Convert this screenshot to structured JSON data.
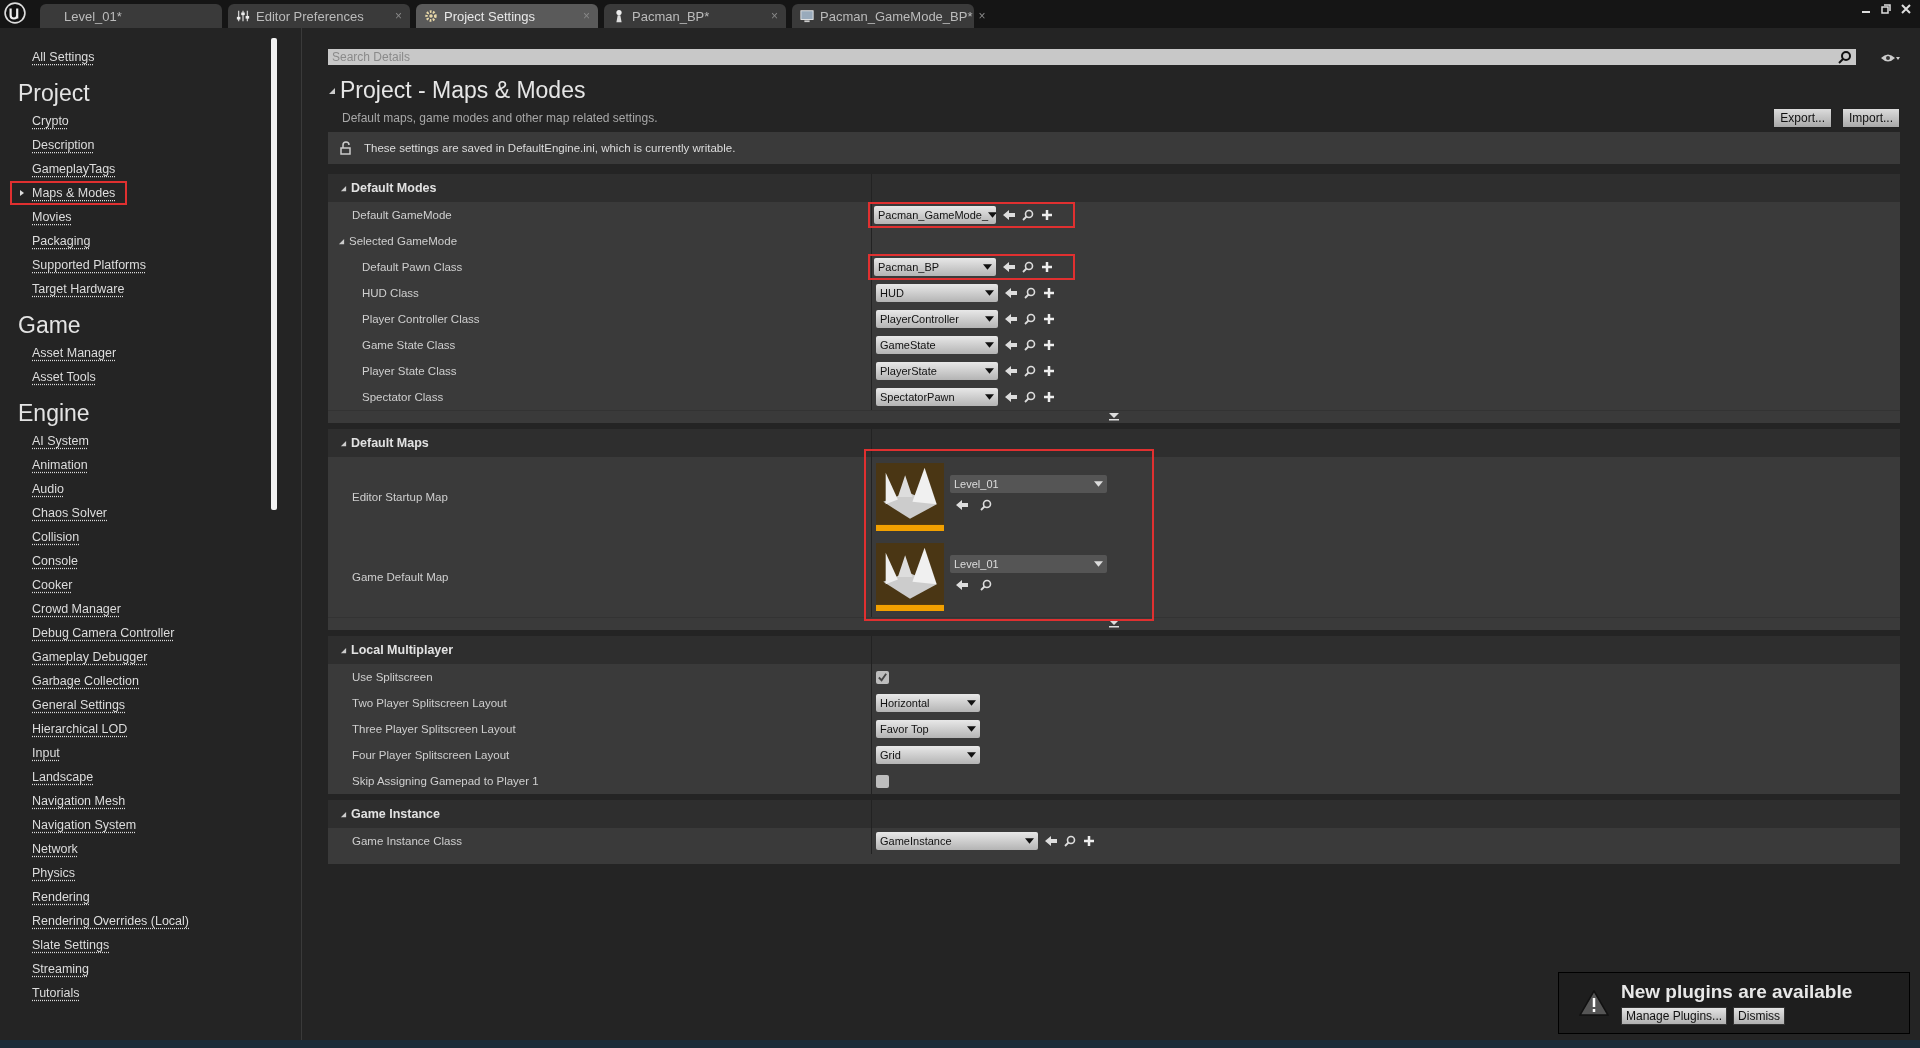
{
  "tabs": [
    {
      "label": "Level_01*",
      "kind": "level",
      "selected": false
    },
    {
      "label": "Editor Preferences",
      "kind": "preferences",
      "selected": false,
      "close": "×"
    },
    {
      "label": "Project Settings",
      "kind": "settings",
      "selected": true,
      "close": "×"
    },
    {
      "label": "Pacman_BP*",
      "kind": "blueprint",
      "selected": false,
      "close": "×"
    },
    {
      "label": "Pacman_GameMode_BP*",
      "kind": "gamemode",
      "selected": false,
      "close": "×"
    }
  ],
  "sidebar": {
    "all_settings": "All Settings",
    "groups": [
      {
        "heading": "Project",
        "items": [
          {
            "label": "Crypto",
            "selected": false
          },
          {
            "label": "Description",
            "selected": false
          },
          {
            "label": "GameplayTags",
            "selected": false
          },
          {
            "label": "Maps & Modes",
            "selected": true
          },
          {
            "label": "Movies",
            "selected": false
          },
          {
            "label": "Packaging",
            "selected": false
          },
          {
            "label": "Supported Platforms",
            "selected": false
          },
          {
            "label": "Target Hardware",
            "selected": false
          }
        ]
      },
      {
        "heading": "Game",
        "items": [
          {
            "label": "Asset Manager",
            "selected": false
          },
          {
            "label": "Asset Tools",
            "selected": false
          }
        ]
      },
      {
        "heading": "Engine",
        "items": [
          {
            "label": "AI System",
            "selected": false
          },
          {
            "label": "Animation",
            "selected": false
          },
          {
            "label": "Audio",
            "selected": false
          },
          {
            "label": "Chaos Solver",
            "selected": false
          },
          {
            "label": "Collision",
            "selected": false
          },
          {
            "label": "Console",
            "selected": false
          },
          {
            "label": "Cooker",
            "selected": false
          },
          {
            "label": "Crowd Manager",
            "selected": false
          },
          {
            "label": "Debug Camera Controller",
            "selected": false
          },
          {
            "label": "Gameplay Debugger",
            "selected": false
          },
          {
            "label": "Garbage Collection",
            "selected": false
          },
          {
            "label": "General Settings",
            "selected": false
          },
          {
            "label": "Hierarchical LOD",
            "selected": false
          },
          {
            "label": "Input",
            "selected": false
          },
          {
            "label": "Landscape",
            "selected": false
          },
          {
            "label": "Navigation Mesh",
            "selected": false
          },
          {
            "label": "Navigation System",
            "selected": false
          },
          {
            "label": "Network",
            "selected": false
          },
          {
            "label": "Physics",
            "selected": false
          },
          {
            "label": "Rendering",
            "selected": false
          },
          {
            "label": "Rendering Overrides (Local)",
            "selected": false
          },
          {
            "label": "Slate Settings",
            "selected": false
          },
          {
            "label": "Streaming",
            "selected": false
          },
          {
            "label": "Tutorials",
            "selected": false
          }
        ]
      }
    ]
  },
  "details": {
    "search": {
      "placeholder": "Search Details"
    },
    "title": "Project - Maps & Modes",
    "description": "Default maps, game modes and other map related settings.",
    "buttons": [
      "Export...",
      "Import..."
    ],
    "info": "These settings are saved in DefaultEngine.ini, which is currently writable.",
    "sections": [
      {
        "title": "Default Modes",
        "expanded": true,
        "advanced": true,
        "rows": [
          {
            "kind": "class",
            "label": "Default GameMode",
            "value": "Pacman_GameMode_",
            "highlighted": true
          },
          {
            "kind": "group",
            "label": "Selected GameMode",
            "expanded": true,
            "children": [
              {
                "kind": "class",
                "label": "Default Pawn Class",
                "value": "Pacman_BP",
                "highlighted": true
              },
              {
                "kind": "class",
                "label": "HUD Class",
                "value": "HUD"
              },
              {
                "kind": "class",
                "label": "Player Controller Class",
                "value": "PlayerController"
              },
              {
                "kind": "class",
                "label": "Game State Class",
                "value": "GameState"
              },
              {
                "kind": "class",
                "label": "Player State Class",
                "value": "PlayerState"
              },
              {
                "kind": "class",
                "label": "Spectator Class",
                "value": "SpectatorPawn"
              }
            ]
          }
        ]
      },
      {
        "title": "Default Maps",
        "expanded": true,
        "advanced": true,
        "highlighted": true,
        "rows": [
          {
            "kind": "map",
            "label": "Editor Startup Map",
            "value": "Level_01"
          },
          {
            "kind": "map",
            "label": "Game Default Map",
            "value": "Level_01"
          }
        ]
      },
      {
        "title": "Local Multiplayer",
        "expanded": true,
        "rows": [
          {
            "kind": "checkbox",
            "label": "Use Splitscreen",
            "checked": true
          },
          {
            "kind": "enum",
            "label": "Two Player Splitscreen Layout",
            "value": "Horizontal"
          },
          {
            "kind": "enum",
            "label": "Three Player Splitscreen Layout",
            "value": "Favor Top"
          },
          {
            "kind": "enum",
            "label": "Four Player Splitscreen Layout",
            "value": "Grid"
          },
          {
            "kind": "checkbox",
            "label": "Skip Assigning Gamepad to Player 1",
            "checked": false
          }
        ]
      },
      {
        "title": "Game Instance",
        "expanded": true,
        "rows": [
          {
            "kind": "wideclass",
            "label": "Game Instance Class",
            "value": "GameInstance"
          }
        ]
      }
    ]
  },
  "notification": {
    "title": "New plugins are available",
    "buttons": [
      "Manage Plugins...",
      "Dismiss"
    ]
  }
}
